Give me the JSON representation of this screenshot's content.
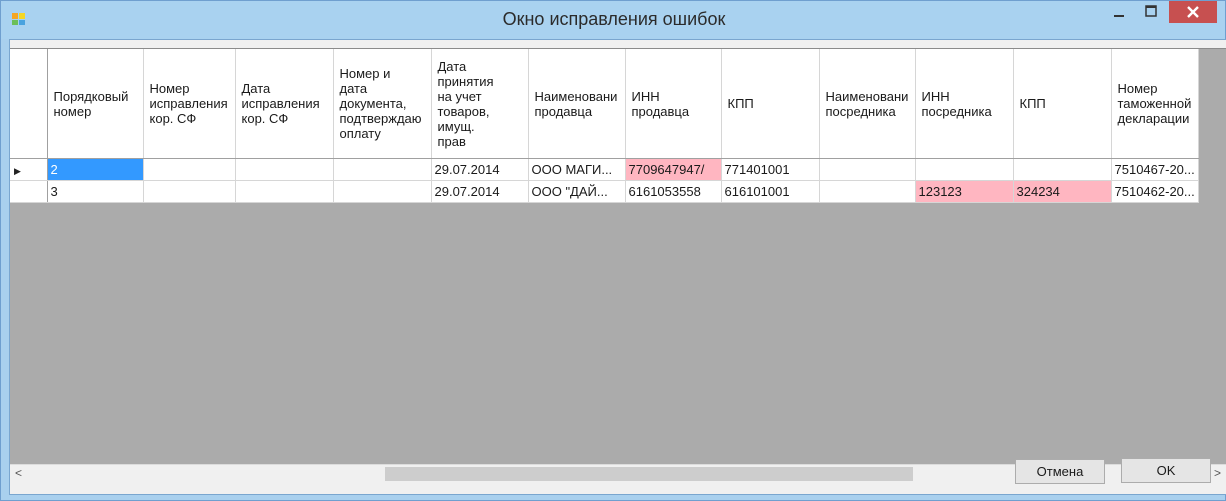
{
  "window": {
    "title": "Окно исправления ошибок"
  },
  "grid": {
    "columns": [
      "Порядковый номер",
      "Номер исправления кор. СФ",
      "Дата исправления кор. СФ",
      "Номер и дата документа, подтверждающего оплату",
      "Дата принятия на учет товаров, имущ. прав",
      "Наименование продавца",
      "ИНН продавца",
      "КПП",
      "Наименование посредника",
      "ИНН посредника",
      "КПП",
      "Номер таможенной декларации"
    ],
    "column_labels_visible": [
      [
        "Порядковый",
        "номер"
      ],
      [
        "Номер",
        "исправления",
        "кор. СФ"
      ],
      [
        "Дата",
        "исправления",
        "кор. СФ"
      ],
      [
        "Номер и",
        "дата",
        "документа,",
        "подтверждаю",
        "оплату"
      ],
      [
        "Дата",
        "принятия",
        "на учет",
        "товаров,",
        "имущ.",
        "прав"
      ],
      [
        "Наименовани",
        "продавца"
      ],
      [
        "ИНН",
        "продавца"
      ],
      [
        "КПП"
      ],
      [
        "Наименовани",
        "посредника"
      ],
      [
        "ИНН",
        "посредника"
      ],
      [
        "КПП"
      ],
      [
        "Номер",
        "таможенной",
        "декларации"
      ]
    ],
    "rows": [
      [
        "2",
        "",
        "",
        "",
        "29.07.2014",
        "ООО МАГИ...",
        "7709647947/",
        "771401001",
        "",
        "",
        "",
        "7510467-20..."
      ],
      [
        "3",
        "",
        "",
        "",
        "29.07.2014",
        "ООО \"ДАЙ...",
        "6161053558",
        "616101001",
        "",
        "123123",
        "324234",
        "7510462-20..."
      ]
    ],
    "current_row_marker": "▶"
  },
  "scrollbar": {
    "left_arrow": "<",
    "right_arrow": ">"
  },
  "buttons": {
    "cancel": "Отмена",
    "ok": "OK"
  },
  "titlebar_buttons": {
    "minimize": "—",
    "maximize": "☐",
    "close": "✕"
  },
  "colors": {
    "selected_cell": "#3399ff",
    "error_cell": "#ffb6c1",
    "close_button": "#c75050",
    "titlebar": "#a9d2f0"
  }
}
